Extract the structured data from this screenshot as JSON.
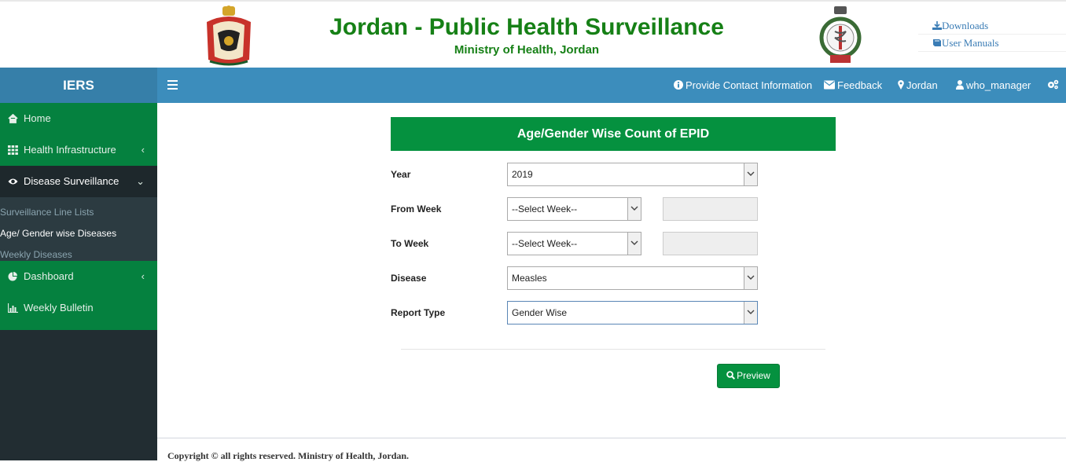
{
  "header": {
    "title": "Jordan - Public Health Surveillance",
    "subtitle": "Ministry of Health, Jordan",
    "links": [
      {
        "label": "Downloads",
        "icon": "download-icon"
      },
      {
        "label": "User Manuals",
        "icon": "book-icon"
      }
    ]
  },
  "sidebar": {
    "brand": "IERS",
    "items": [
      {
        "label": "Home",
        "icon": "home-icon"
      },
      {
        "label": "Health Infrastructure",
        "icon": "grid-icon",
        "chevron": "‹"
      },
      {
        "label": "Disease Surveillance",
        "icon": "eye-icon",
        "chevron": "⌄"
      }
    ],
    "submenu": [
      {
        "label": "Surveillance Line Lists"
      },
      {
        "label": "Age/ Gender wise Diseases"
      },
      {
        "label": "Weekly Diseases"
      }
    ],
    "items_after": [
      {
        "label": "Dashboard",
        "icon": "pie-chart-icon",
        "chevron": "‹"
      },
      {
        "label": "Weekly Bulletin",
        "icon": "bar-chart-icon"
      }
    ]
  },
  "topbar": {
    "items": [
      {
        "label": "Provide Contact Information",
        "icon": "info-icon"
      },
      {
        "label": "Feedback",
        "icon": "envelope-icon"
      },
      {
        "label": "Jordan",
        "icon": "map-marker-icon"
      },
      {
        "label": "who_manager",
        "icon": "user-icon"
      }
    ],
    "settings_icon": "gears-icon"
  },
  "form": {
    "title": "Age/Gender Wise Count of EPID",
    "year_label": "Year",
    "year_value": "2019",
    "from_week_label": "From Week",
    "from_week_value": "--Select Week--",
    "to_week_label": "To Week",
    "to_week_value": "--Select Week--",
    "disease_label": "Disease",
    "disease_value": "Measles",
    "report_type_label": "Report Type",
    "report_type_value": "Gender Wise",
    "preview_label": "Preview"
  },
  "footer": {
    "text": "Copyright © all rights reserved. Ministry of Health, Jordan."
  },
  "colors": {
    "brand_blue": "#3c8dbc",
    "sidebar_green": "#05813f",
    "title_green": "#168016",
    "button_green": "#05913f"
  }
}
